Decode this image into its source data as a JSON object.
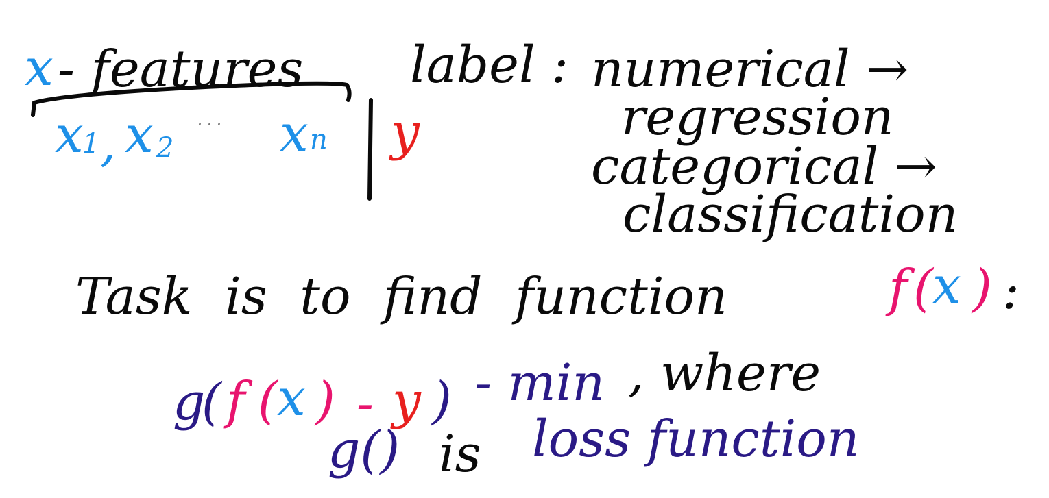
{
  "features": {
    "x": "x",
    "dash_text": "- features",
    "x1": "x",
    "x1_sub": "1",
    "comma": ",",
    "x2": "x",
    "x2_sub": "2",
    "dots": "· · ·",
    "xn": "x",
    "xn_sub": "n",
    "y": "y"
  },
  "label": {
    "title": "label :",
    "numerical": "numerical →",
    "regression": "regression",
    "categorical": "categorical →",
    "classification": "classification"
  },
  "task": {
    "text": "Task is to find function",
    "f": "f",
    "open": "(",
    "x": "x",
    "close": ")",
    "colon": ":"
  },
  "formula": {
    "g": "g",
    "open": "(",
    "f": "f",
    "fx_open": "(",
    "x": "x",
    "fx_close": ")",
    "minus": "-",
    "y": "y",
    "close": ")",
    "min": "- min",
    "where": ", where"
  },
  "loss": {
    "g_paren": "g()",
    "is": "is",
    "text": "loss function"
  },
  "colors": {
    "blue": "#1e90e8",
    "black": "#0a0a0a",
    "red": "#e8201e",
    "pink": "#e8146e",
    "navy": "#2a1a86"
  }
}
